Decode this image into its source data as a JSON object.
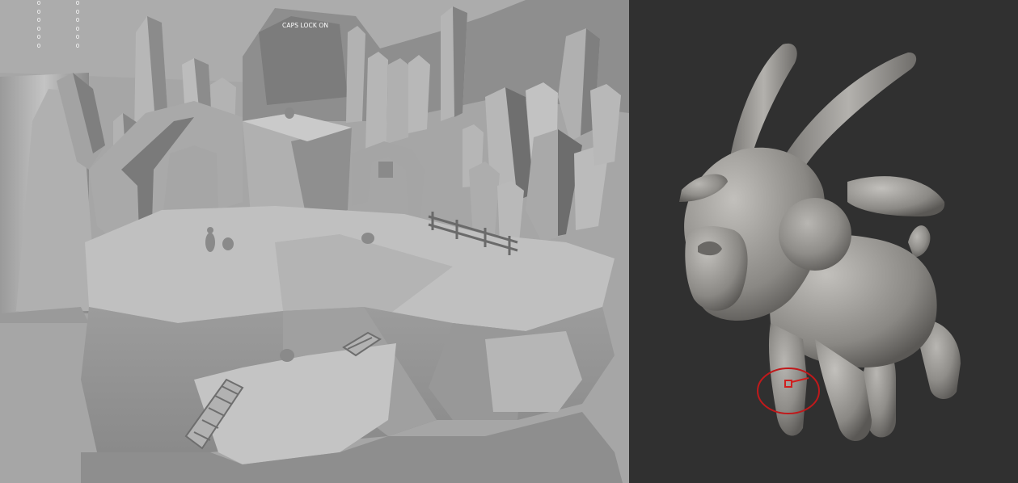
{
  "left_viewport": {
    "stats_col1": [
      "0",
      "0",
      "0",
      "0",
      "0",
      "0"
    ],
    "stats_col2": [
      "0",
      "0",
      "0",
      "0",
      "0",
      "0"
    ],
    "caps_lock": "CAPS LOCK ON",
    "scene": "low-poly-rock-island-blockout"
  },
  "right_viewport": {
    "model": "goat-sculpt",
    "brush_cursor_color": "#c0191b",
    "background": "#303030"
  }
}
